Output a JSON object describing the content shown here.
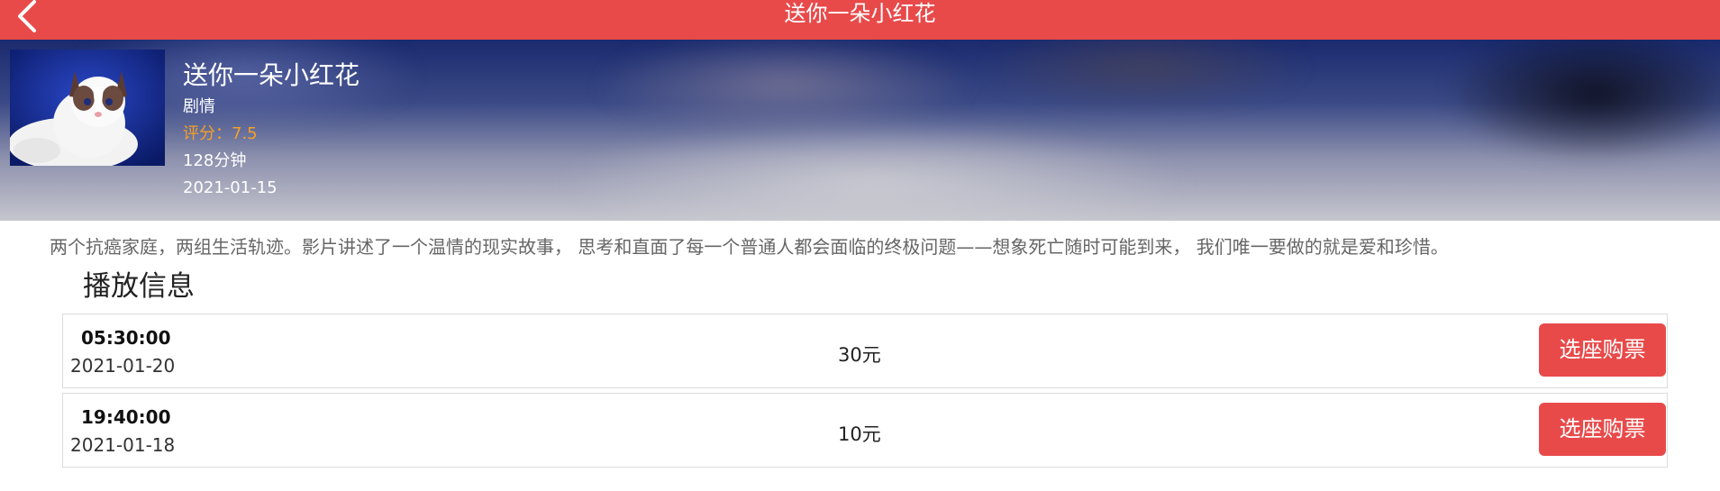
{
  "topbar": {
    "title": "送你一朵小红花",
    "back_icon": "chevron-left-icon"
  },
  "movie": {
    "title": "送你一朵小红花",
    "genre": "剧情",
    "rating": "评分：7.5",
    "duration": "128分钟",
    "release_date": "2021-01-15",
    "synopsis": "两个抗癌家庭，两组生活轨迹。影片讲述了一个温情的现实故事， 思考和直面了每一个普通人都会面临的终极问题——想象死亡随时可能到来， 我们唯一要做的就是爱和珍惜。"
  },
  "schedule": {
    "section_title": "播放信息",
    "shows": [
      {
        "time": "05:30:00",
        "date": "2021-01-20",
        "price": "30元",
        "button": "选座购票"
      },
      {
        "time": "19:40:00",
        "date": "2021-01-18",
        "price": "10元",
        "button": "选座购票"
      }
    ]
  },
  "colors": {
    "accent": "#e84a4a",
    "rating": "#f4a028"
  }
}
